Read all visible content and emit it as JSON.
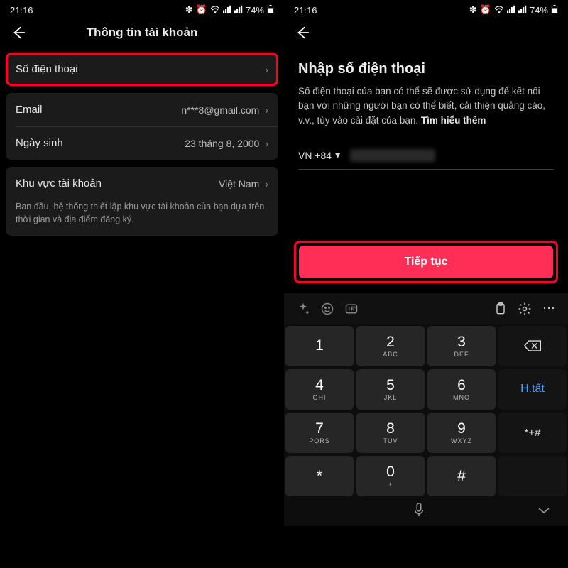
{
  "status": {
    "time": "21:16",
    "battery": "74%"
  },
  "left": {
    "title": "Thông tin tài khoản",
    "rows": {
      "phone": {
        "label": "Số điện thoại"
      },
      "email": {
        "label": "Email",
        "value": "n***8@gmail.com"
      },
      "dob": {
        "label": "Ngày sinh",
        "value": "23 tháng 8, 2000"
      },
      "region": {
        "label": "Khu vực tài khoản",
        "value": "Việt Nam"
      }
    },
    "region_note": "Ban đầu, hệ thống thiết lập khu vực tài khoản của bạn dựa trên thời gian và địa điểm đăng ký."
  },
  "right": {
    "title": "Nhập số điện thoại",
    "desc": "Số điện thoại của bạn có thể sẽ được sử dụng để kết nối bạn với những người bạn có thể biết, cải thiện quảng cáo, v.v., tùy vào cài đặt của bạn. ",
    "desc_bold": "Tìm hiểu thêm",
    "country_code": "VN +84",
    "continue": "Tiếp tục",
    "keypad": {
      "r1": [
        {
          "n": "1",
          "s": ""
        },
        {
          "n": "2",
          "s": "ABC"
        },
        {
          "n": "3",
          "s": "DEF"
        }
      ],
      "r2": [
        {
          "n": "4",
          "s": "GHI"
        },
        {
          "n": "5",
          "s": "JKL"
        },
        {
          "n": "6",
          "s": "MNO"
        }
      ],
      "r3": [
        {
          "n": "7",
          "s": "PQRS"
        },
        {
          "n": "8",
          "s": "TUV"
        },
        {
          "n": "9",
          "s": "WXYZ"
        }
      ],
      "r4": [
        {
          "n": "*",
          "s": ""
        },
        {
          "n": "0",
          "s": "+"
        },
        {
          "n": "#",
          "s": ""
        }
      ],
      "done": "H.tất",
      "sym": "*+#"
    }
  }
}
